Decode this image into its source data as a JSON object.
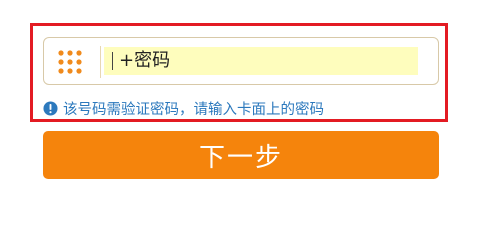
{
  "password_field": {
    "value": "+密码",
    "icon": "keypad-icon"
  },
  "hint": {
    "icon": "info-icon",
    "text": "该号码需验证密码，请输入卡面上的密码"
  },
  "next_button": {
    "label": "下一步"
  },
  "colors": {
    "highlight_border": "#e31b23",
    "button_bg": "#f5840c",
    "hint_text": "#2c79bd",
    "input_bg": "#fefdbd",
    "keypad_dots": "#f08a1c"
  }
}
